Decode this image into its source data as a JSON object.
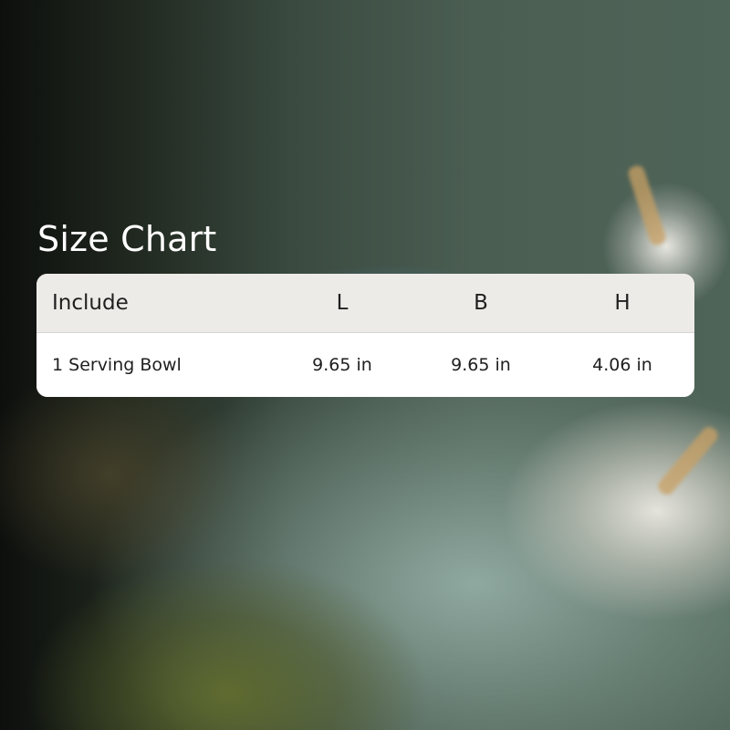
{
  "title": "Size Chart",
  "table": {
    "headers": [
      "Include",
      "L",
      "B",
      "H"
    ],
    "rows": [
      [
        "1 Serving Bowl",
        "9.65 in",
        "9.65 in",
        "4.06 in"
      ]
    ]
  }
}
